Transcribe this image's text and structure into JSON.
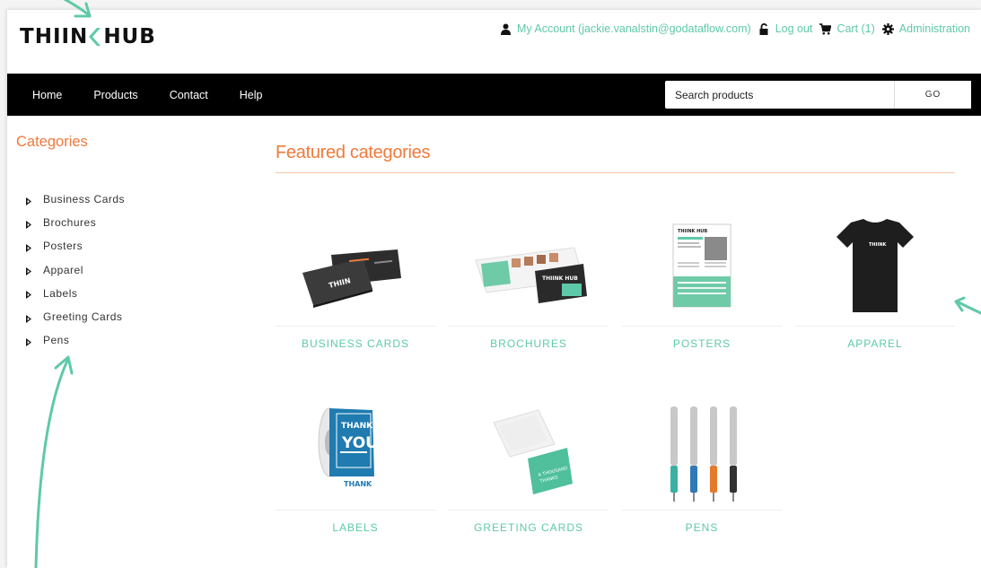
{
  "brand": {
    "logo_text_left": "THIIN",
    "logo_text_right": "HUB"
  },
  "top_links": {
    "account": "My Account (jackie.vanalstin@godataflow.com)",
    "logout": "Log out",
    "cart": "Cart (1)",
    "admin": "Administration"
  },
  "nav": {
    "items": [
      "Home",
      "Products",
      "Contact",
      "Help"
    ]
  },
  "search": {
    "placeholder": "Search products",
    "go_label": "GO"
  },
  "sidebar": {
    "title": "Categories",
    "items": [
      "Business Cards",
      "Brochures",
      "Posters",
      "Apparel",
      "Labels",
      "Greeting Cards",
      "Pens"
    ]
  },
  "featured": {
    "title": "Featured categories",
    "cards": [
      {
        "label": "BUSINESS CARDS",
        "icon": "business-cards-image"
      },
      {
        "label": "BROCHURES",
        "icon": "brochures-image"
      },
      {
        "label": "POSTERS",
        "icon": "posters-image"
      },
      {
        "label": "APPAREL",
        "icon": "apparel-image"
      },
      {
        "label": "LABELS",
        "icon": "labels-image"
      },
      {
        "label": "GREETING CARDS",
        "icon": "greeting-cards-image"
      },
      {
        "label": "PENS",
        "icon": "pens-image"
      }
    ]
  },
  "colors": {
    "accent": "#5ec9a8",
    "heading": "#ef7a3c",
    "nav_bg": "#000000"
  }
}
